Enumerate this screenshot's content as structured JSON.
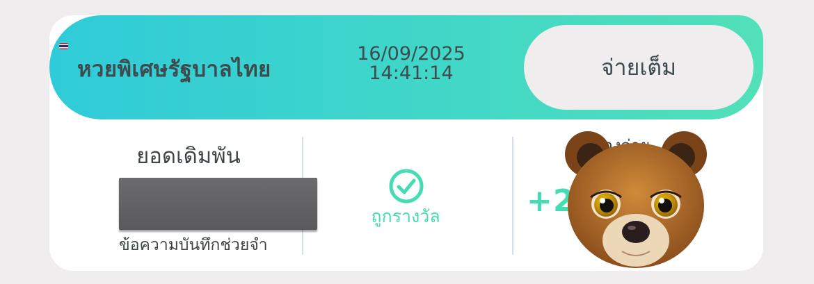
{
  "lottery": {
    "name": "หวยพิเศษรัฐบาลไทย",
    "date": "16/09/2025",
    "time": "14:41:14",
    "pay_button_label": "จ่ายเต็ม"
  },
  "bet": {
    "label": "ยอดเดิมพัน",
    "memo": "ข้อความบันทึกช่วยจำ"
  },
  "result": {
    "status": "ถูกรางวัล",
    "payout_label": "ต้องจ่าย",
    "payout_amount": "+2"
  },
  "colors": {
    "accent_green": "#45dcb4",
    "header_start": "#2fcbd9",
    "header_end": "#52e0b8"
  },
  "icons": [
    "thai-flag-icon",
    "check-circle-icon",
    "bear-avatar"
  ]
}
